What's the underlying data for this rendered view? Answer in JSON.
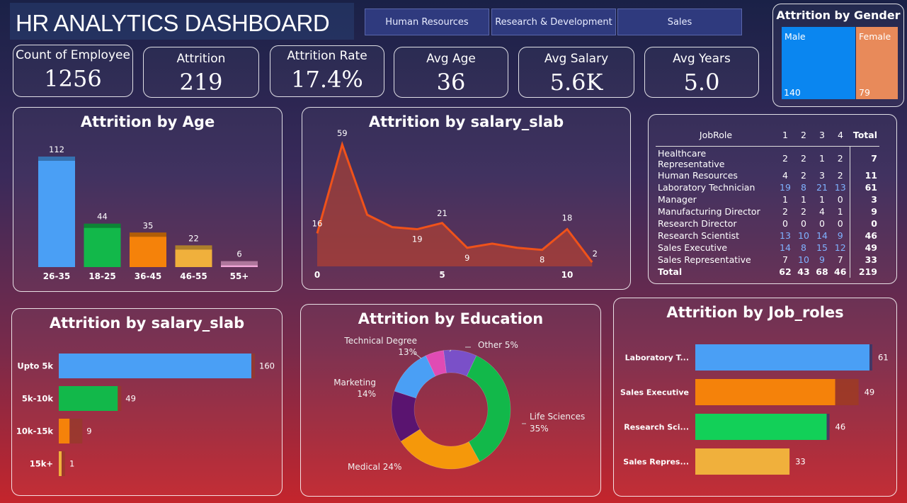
{
  "header": {
    "title": "HR ANALYTICS  DASHBOARD"
  },
  "departments": [
    "Human Resources",
    "Research & Development",
    "Sales"
  ],
  "kpis": [
    {
      "label": "Count of Employee",
      "value": "1256"
    },
    {
      "label": "Attrition",
      "value": "219"
    },
    {
      "label": "Attrition Rate",
      "value": "17.4%"
    },
    {
      "label": "Avg Age",
      "value": "36"
    },
    {
      "label": "Avg Salary",
      "value": "5.6K"
    },
    {
      "label": "Avg Years",
      "value": "5.0"
    }
  ],
  "gender": {
    "title": "Attrition by Gender",
    "male_label": "Male",
    "female_label": "Female",
    "male_value": "140",
    "female_value": "79"
  },
  "colors": {
    "blue": "#4a9ff5",
    "green": "#12b84a",
    "orange": "#f5820a",
    "gold": "#f0b03c",
    "pink": "#f2a6d8",
    "line": "#f0521a"
  },
  "chart_data": [
    {
      "type": "bar",
      "title": "Attrition by Age",
      "categories": [
        "26-35",
        "18-25",
        "36-45",
        "46-55",
        "55+"
      ],
      "values": [
        112,
        44,
        35,
        22,
        6
      ]
    },
    {
      "type": "area",
      "title": "Attrition by salary_slab",
      "x": [
        0,
        1,
        2,
        3,
        4,
        5,
        6,
        7,
        8,
        9,
        10,
        11
      ],
      "values": [
        16,
        59,
        25,
        19,
        18,
        21,
        9,
        11,
        9,
        8,
        18,
        2
      ],
      "value_labels": [
        "16",
        "59",
        "",
        "",
        "19",
        "21",
        "9",
        "",
        "",
        "8",
        "18",
        "2"
      ],
      "xticks": [
        "0",
        "5",
        "10"
      ]
    },
    {
      "type": "bar",
      "title": "Attrition by salary_slab",
      "categories": [
        "Upto 5k",
        "5k-10k",
        "10k-15k",
        "15k+"
      ],
      "values": [
        160,
        49,
        9,
        1
      ]
    },
    {
      "type": "pie",
      "title": "Attrition by Education",
      "labels": [
        "Life Sciences",
        "Medical",
        "Marketing",
        "Technical Degree",
        "Other"
      ],
      "percent_labels": [
        "35%",
        "24%",
        "14%",
        "13%",
        "5%"
      ],
      "values": [
        35,
        24,
        14,
        13,
        5
      ]
    },
    {
      "type": "bar",
      "title": "Attrition by Job_roles",
      "categories": [
        "Laboratory T...",
        "Sales Executive",
        "Research Sci...",
        "Sales Repres..."
      ],
      "values": [
        61,
        49,
        46,
        33
      ]
    },
    {
      "type": "table",
      "columns": [
        "JobRole",
        "1",
        "2",
        "3",
        "4",
        "Total"
      ],
      "rows": [
        [
          "Healthcare Representative",
          "2",
          "2",
          "1",
          "2",
          "7"
        ],
        [
          "Human Resources",
          "4",
          "2",
          "3",
          "2",
          "11"
        ],
        [
          "Laboratory Technician",
          "19",
          "8",
          "21",
          "13",
          "61"
        ],
        [
          "Manager",
          "1",
          "1",
          "1",
          "0",
          "3"
        ],
        [
          "Manufacturing Director",
          "2",
          "2",
          "4",
          "1",
          "9"
        ],
        [
          "Research Director",
          "0",
          "0",
          "0",
          "0",
          "0"
        ],
        [
          "Research Scientist",
          "13",
          "10",
          "14",
          "9",
          "46"
        ],
        [
          "Sales Executive",
          "14",
          "8",
          "15",
          "12",
          "49"
        ],
        [
          "Sales Representative",
          "7",
          "10",
          "9",
          "7",
          "33"
        ],
        [
          "Total",
          "62",
          "43",
          "68",
          "46",
          "219"
        ]
      ]
    }
  ]
}
